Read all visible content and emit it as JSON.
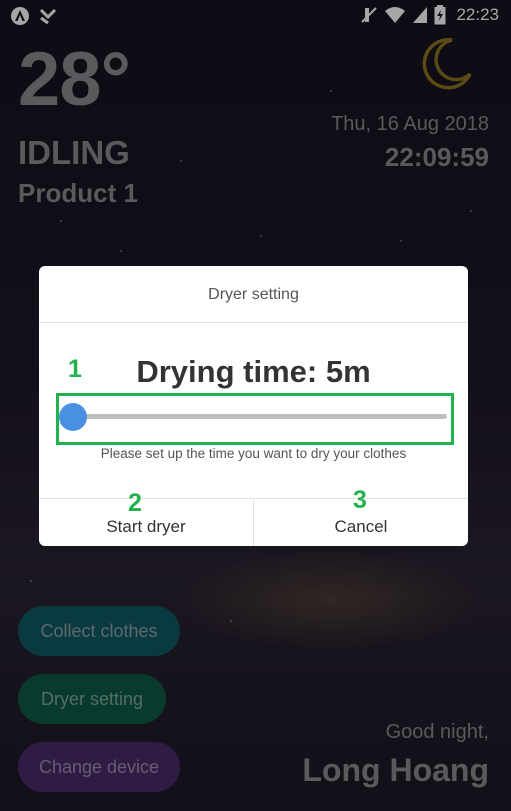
{
  "status_bar": {
    "time": "22:23",
    "icons": [
      "app-logo-icon",
      "download-icon",
      "mute-icon",
      "wifi-icon",
      "signal-icon",
      "battery-icon"
    ]
  },
  "weather": {
    "temperature": "28°",
    "state": "IDLING",
    "product": "Product 1",
    "date": "Thu, 16 Aug 2018",
    "time": "22:09:59",
    "icon": "moon-icon"
  },
  "dialog": {
    "title": "Dryer setting",
    "heading": "Drying time: 5m",
    "slider_value_fraction": 0.0,
    "hint": "Please set up the time you want to dry your clothes",
    "start_label": "Start dryer",
    "cancel_label": "Cancel"
  },
  "annotations": {
    "mark1": "1",
    "mark2": "2",
    "mark3": "3",
    "color": "#21b14d"
  },
  "actions": {
    "collect": "Collect clothes",
    "dryer": "Dryer setting",
    "change": "Change device"
  },
  "greeting": {
    "line1": "Good night,",
    "name": "Long Hoang"
  },
  "colors": {
    "accent_blue": "#4a90e2",
    "collect_bg": "#0f5a63",
    "dryer_bg": "#0d5a45",
    "change_bg": "#4b2a6b",
    "moon": "#c9a227"
  }
}
